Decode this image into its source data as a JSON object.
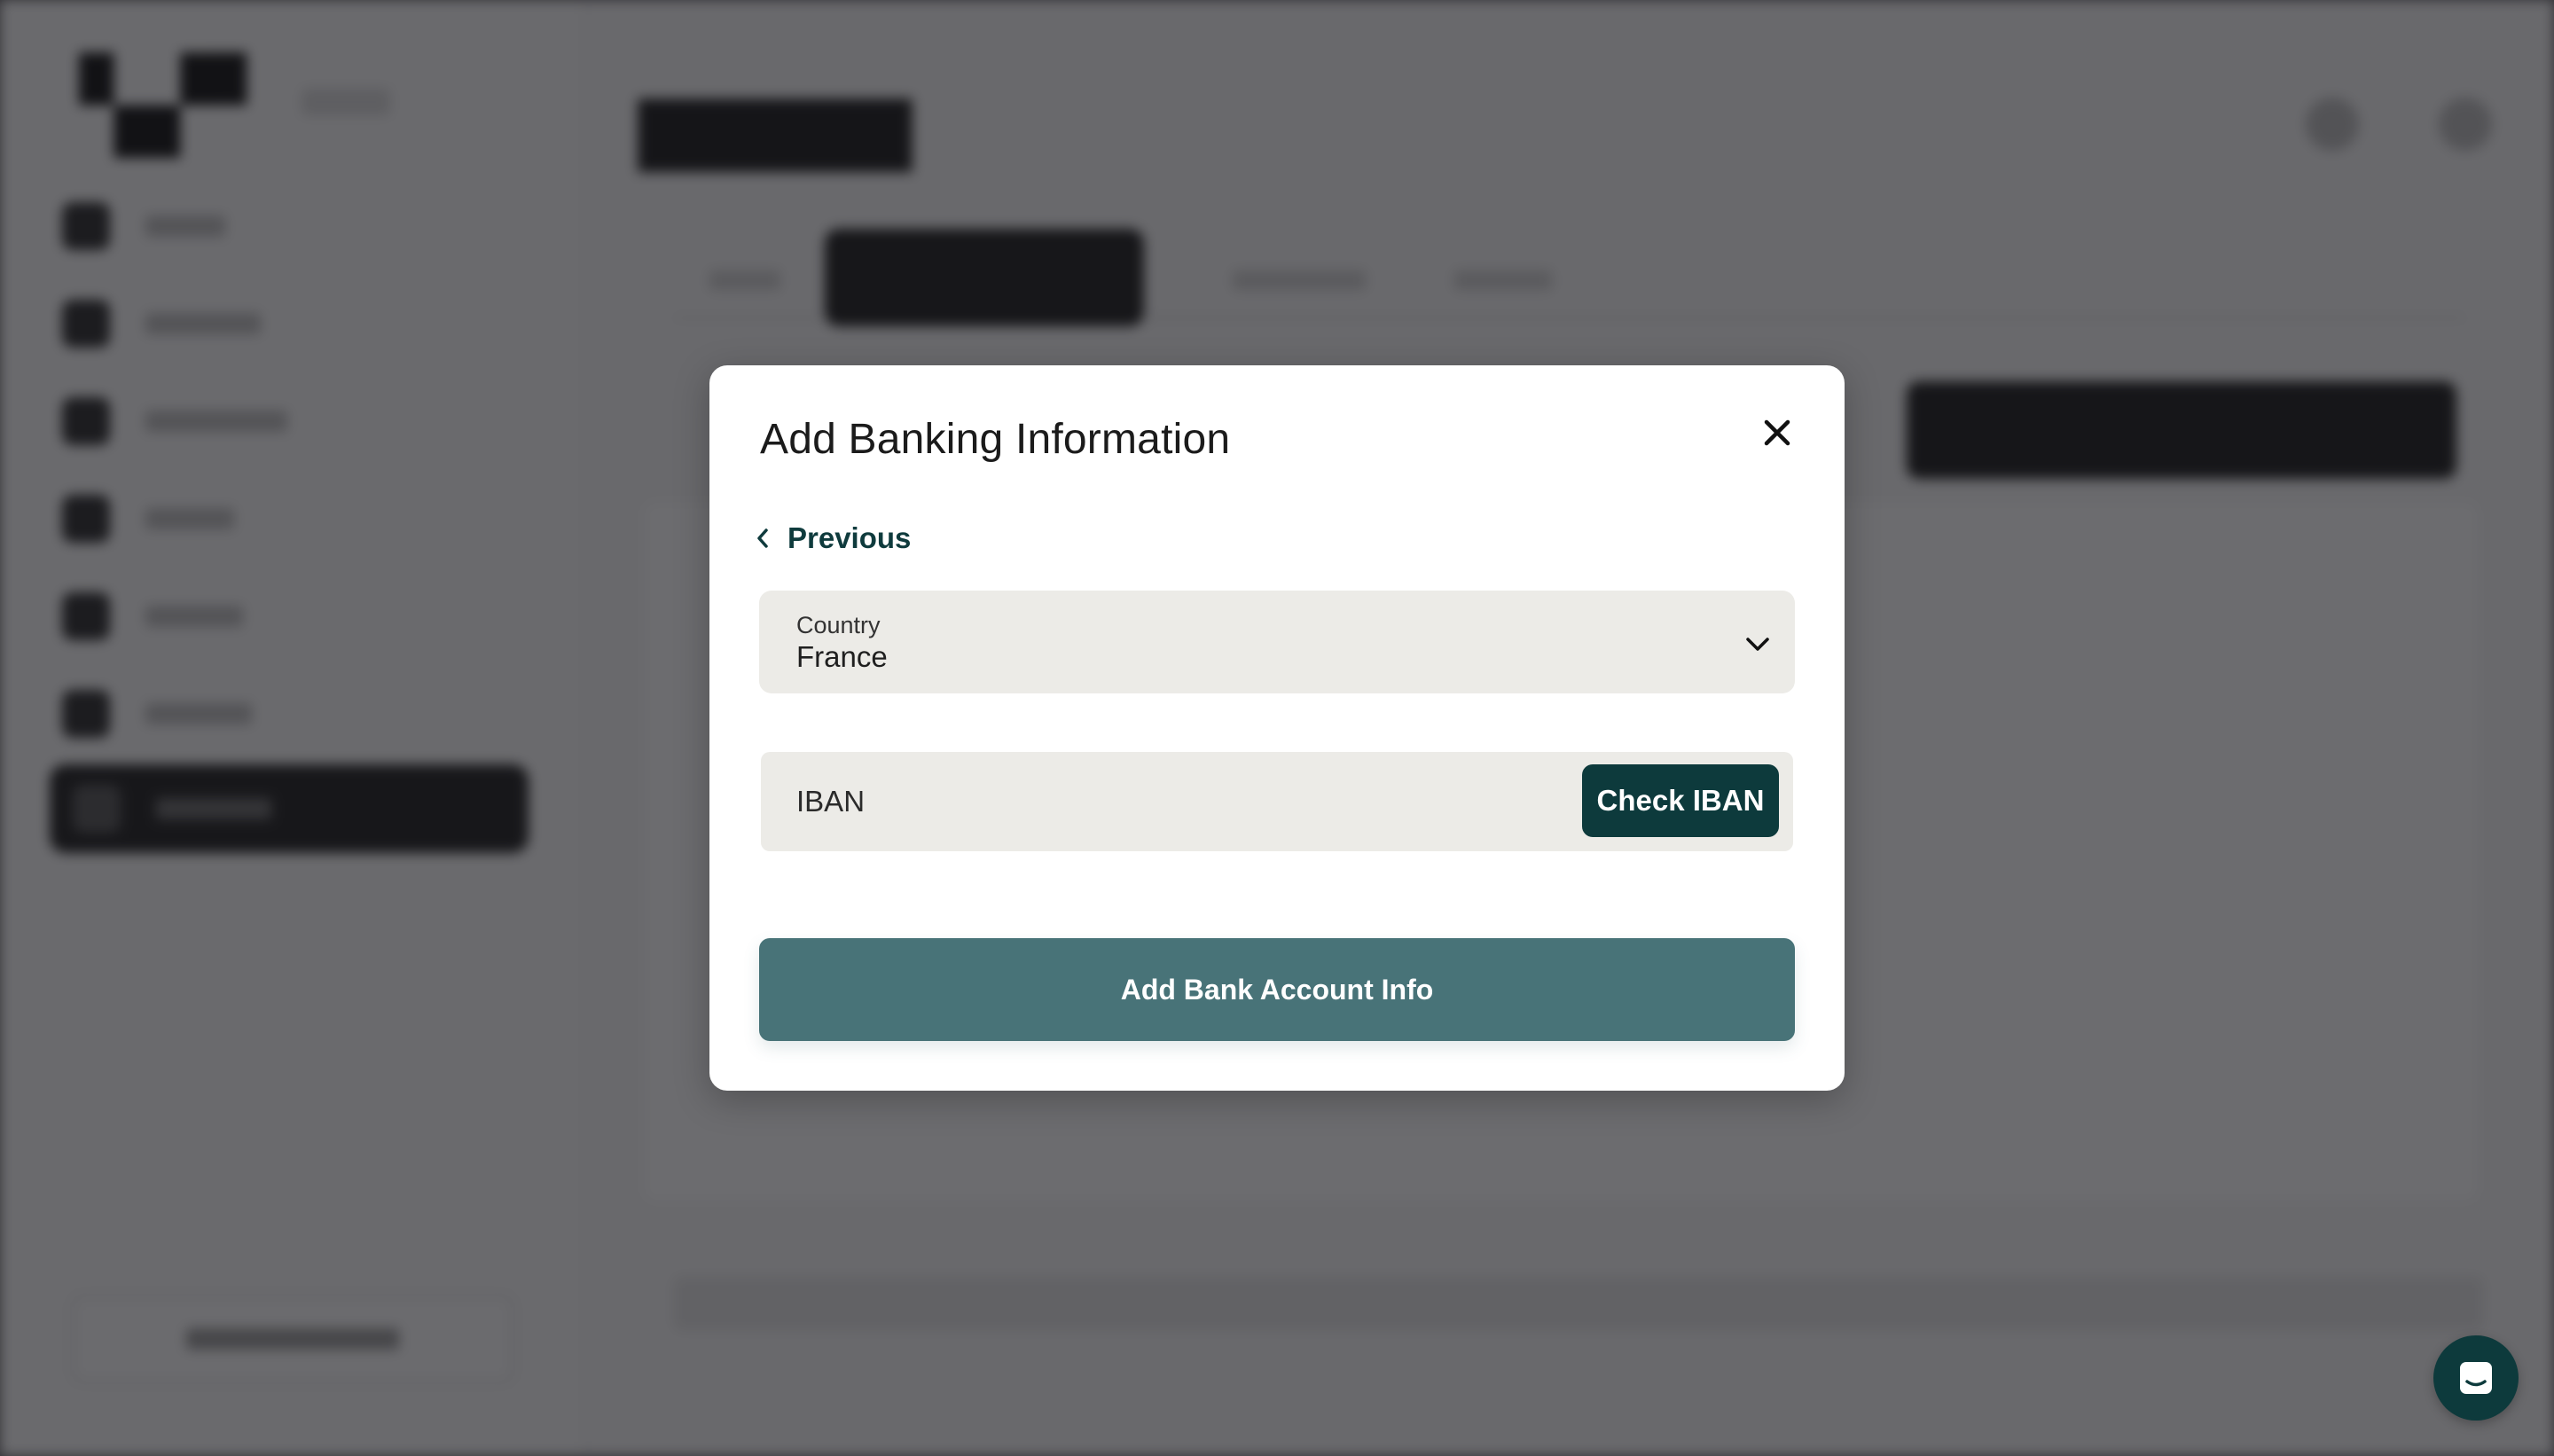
{
  "modal": {
    "title": "Add Banking Information",
    "previous_label": "Previous",
    "country": {
      "label": "Country",
      "value": "France"
    },
    "iban": {
      "placeholder": "IBAN",
      "value": "",
      "check_label": "Check IBAN"
    },
    "submit_label": "Add Bank Account Info"
  },
  "icons": {
    "close": "close-icon",
    "previous": "chevron-left-icon",
    "country_dropdown": "chevron-down-icon",
    "chat": "chat-bubble-icon"
  },
  "colors": {
    "accent_dark": "#0d3a3c",
    "submit_button": "#487378",
    "field_background": "#ecebe7",
    "overlay": "#626064"
  }
}
